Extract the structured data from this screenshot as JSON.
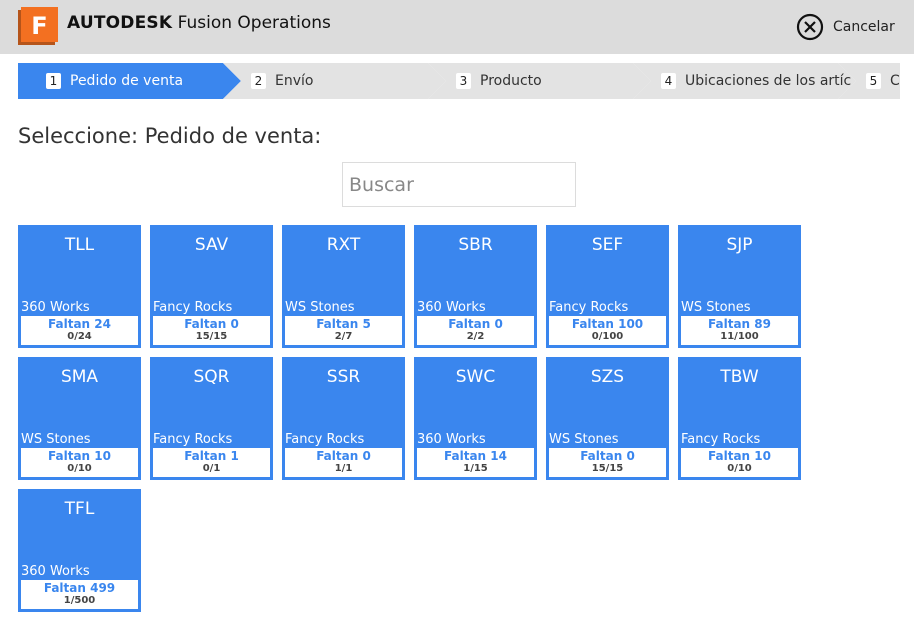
{
  "header": {
    "brand_bold": "AUTODESK",
    "brand_name": "Fusion Operations",
    "cancel_label": "Cancelar",
    "logo_letter": "F"
  },
  "stepper": {
    "steps": [
      {
        "num": "1",
        "label": "Pedido de venta",
        "active": true
      },
      {
        "num": "2",
        "label": "Envío",
        "active": false
      },
      {
        "num": "3",
        "label": "Producto",
        "active": false
      },
      {
        "num": "4",
        "label": "Ubicaciones de los artíc",
        "active": false
      },
      {
        "num": "5",
        "label": "Co",
        "active": false
      }
    ]
  },
  "page": {
    "title": "Seleccione: Pedido de venta:"
  },
  "search": {
    "placeholder": "Buscar",
    "value": ""
  },
  "orders": [
    {
      "code": "TLL",
      "customer": "360 Works",
      "pending": "Faltan 24",
      "qty": "0/24"
    },
    {
      "code": "SAV",
      "customer": "Fancy Rocks",
      "pending": "Faltan 0",
      "qty": "15/15"
    },
    {
      "code": "RXT",
      "customer": "WS Stones",
      "pending": "Faltan 5",
      "qty": "2/7"
    },
    {
      "code": "SBR",
      "customer": "360 Works",
      "pending": "Faltan 0",
      "qty": "2/2"
    },
    {
      "code": "SEF",
      "customer": "Fancy Rocks",
      "pending": "Faltan 100",
      "qty": "0/100"
    },
    {
      "code": "SJP",
      "customer": "WS Stones",
      "pending": "Faltan 89",
      "qty": "11/100"
    },
    {
      "code": "SMA",
      "customer": "WS Stones",
      "pending": "Faltan 10",
      "qty": "0/10"
    },
    {
      "code": "SQR",
      "customer": "Fancy Rocks",
      "pending": "Faltan 1",
      "qty": "0/1"
    },
    {
      "code": "SSR",
      "customer": "Fancy Rocks",
      "pending": "Faltan 0",
      "qty": "1/1"
    },
    {
      "code": "SWC",
      "customer": "360 Works",
      "pending": "Faltan 14",
      "qty": "1/15"
    },
    {
      "code": "SZS",
      "customer": "WS Stones",
      "pending": "Faltan 0",
      "qty": "15/15"
    },
    {
      "code": "TBW",
      "customer": "Fancy Rocks",
      "pending": "Faltan 10",
      "qty": "0/10"
    },
    {
      "code": "TFL",
      "customer": "360 Works",
      "pending": "Faltan 499",
      "qty": "1/500"
    }
  ],
  "colors": {
    "accent": "#3a86ee",
    "logo": "#f37021",
    "header_bg": "#dcdcdc"
  }
}
